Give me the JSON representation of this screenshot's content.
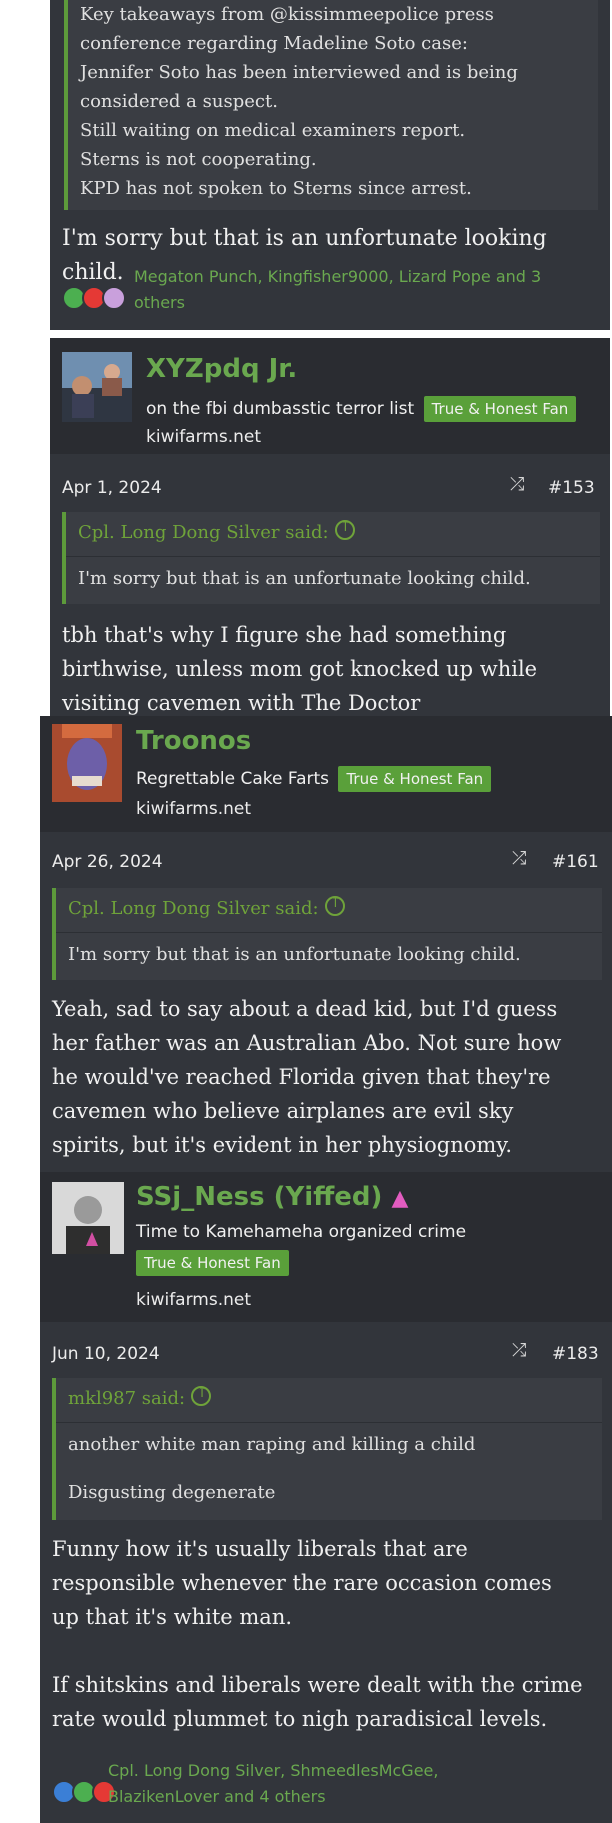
{
  "top": {
    "quote_lines": [
      "Key takeaways from @kissimmeepolice press",
      "conference regarding Madeline Soto case:",
      "Jennifer Soto has been interviewed and is being",
      "considered a suspect.",
      "Still waiting on medical examiners report.",
      "Sterns is not cooperating.",
      "KPD has not spoken to Sterns since arrest."
    ],
    "text": "I'm sorry but that is an unfortunate looking child.",
    "reactions_line1": "Megaton Punch, Kingfisher9000, Lizard Pope and 3",
    "reactions_line2": "others"
  },
  "post153": {
    "username": "XYZpdq Jr.",
    "user_title": "on the fbi dumbasstic terror list",
    "badge": "True & Honest Fan",
    "site": "kiwifarms.net",
    "date": "Apr 1, 2024",
    "number": "#153",
    "quote_author": "Cpl. Long Dong Silver said:",
    "quote_text": "I'm sorry but that is an unfortunate looking child.",
    "lines": [
      "tbh that's why I figure she had something",
      "birthwise, unless mom got knocked up while",
      "visiting cavemen with The Doctor"
    ]
  },
  "post161": {
    "username": "Troonos",
    "user_title": "Regrettable Cake Farts",
    "badge": "True & Honest Fan",
    "site": "kiwifarms.net",
    "date": "Apr 26, 2024",
    "number": "#161",
    "quote_author": "Cpl. Long Dong Silver said:",
    "quote_text": "I'm sorry but that is an unfortunate looking child.",
    "lines": [
      "Yeah, sad to say about a dead kid, but I'd guess",
      "her father was an Australian Abo. Not sure how",
      "he would've reached Florida given that they're",
      "cavemen who believe airplanes are evil sky",
      "spirits, but it's evident in her physiognomy."
    ]
  },
  "post183": {
    "username": "SSj_Ness (Yiffed)",
    "user_title": "Time to Kamehameha organized crime",
    "badge": "True & Honest Fan",
    "site": "kiwifarms.net",
    "date": "Jun 10, 2024",
    "number": "#183",
    "quote_author": "mkl987 said:",
    "quote_line1": "another white man raping and killing a child",
    "quote_line2": "Disgusting degenerate",
    "lines": [
      "Funny how it's usually liberals that are",
      "responsible whenever the rare occasion comes",
      "up that it's white man.",
      "",
      "If shitskins and liberals were dealt with the crime",
      "rate would plummet to nigh paradisical levels."
    ],
    "reactions_line1": "Cpl. Long Dong Silver, ShmeedlesMcGee,",
    "reactions_line2": "BlazikenLover and 4 others"
  },
  "colors": {
    "post_bg": "#32353b",
    "accent_green": "#6aa84f",
    "badge_green": "#5aa03a"
  }
}
